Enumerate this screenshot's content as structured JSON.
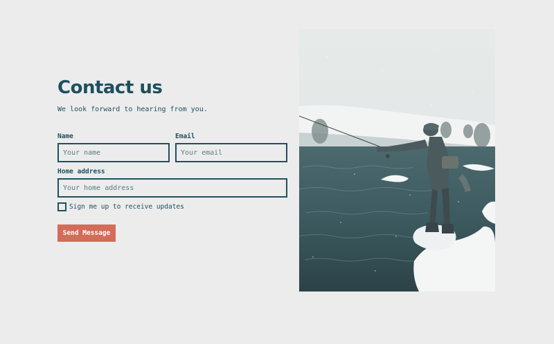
{
  "header": {
    "title": "Contact us",
    "subtitle": "We look forward to hearing from you."
  },
  "form": {
    "name": {
      "label": "Name",
      "placeholder": "Your name"
    },
    "email": {
      "label": "Email",
      "placeholder": "Your email"
    },
    "address": {
      "label": "Home address",
      "placeholder": "Your home address"
    },
    "signup": {
      "label": "Sign me up to receive updates",
      "checked": false
    },
    "submit_label": "Send Message"
  },
  "colors": {
    "background": "#ececec",
    "primary_text": "#1f4f5e",
    "accent": "#d36c58"
  },
  "image": {
    "subject": "fly-fisherman-in-snowy-river"
  }
}
